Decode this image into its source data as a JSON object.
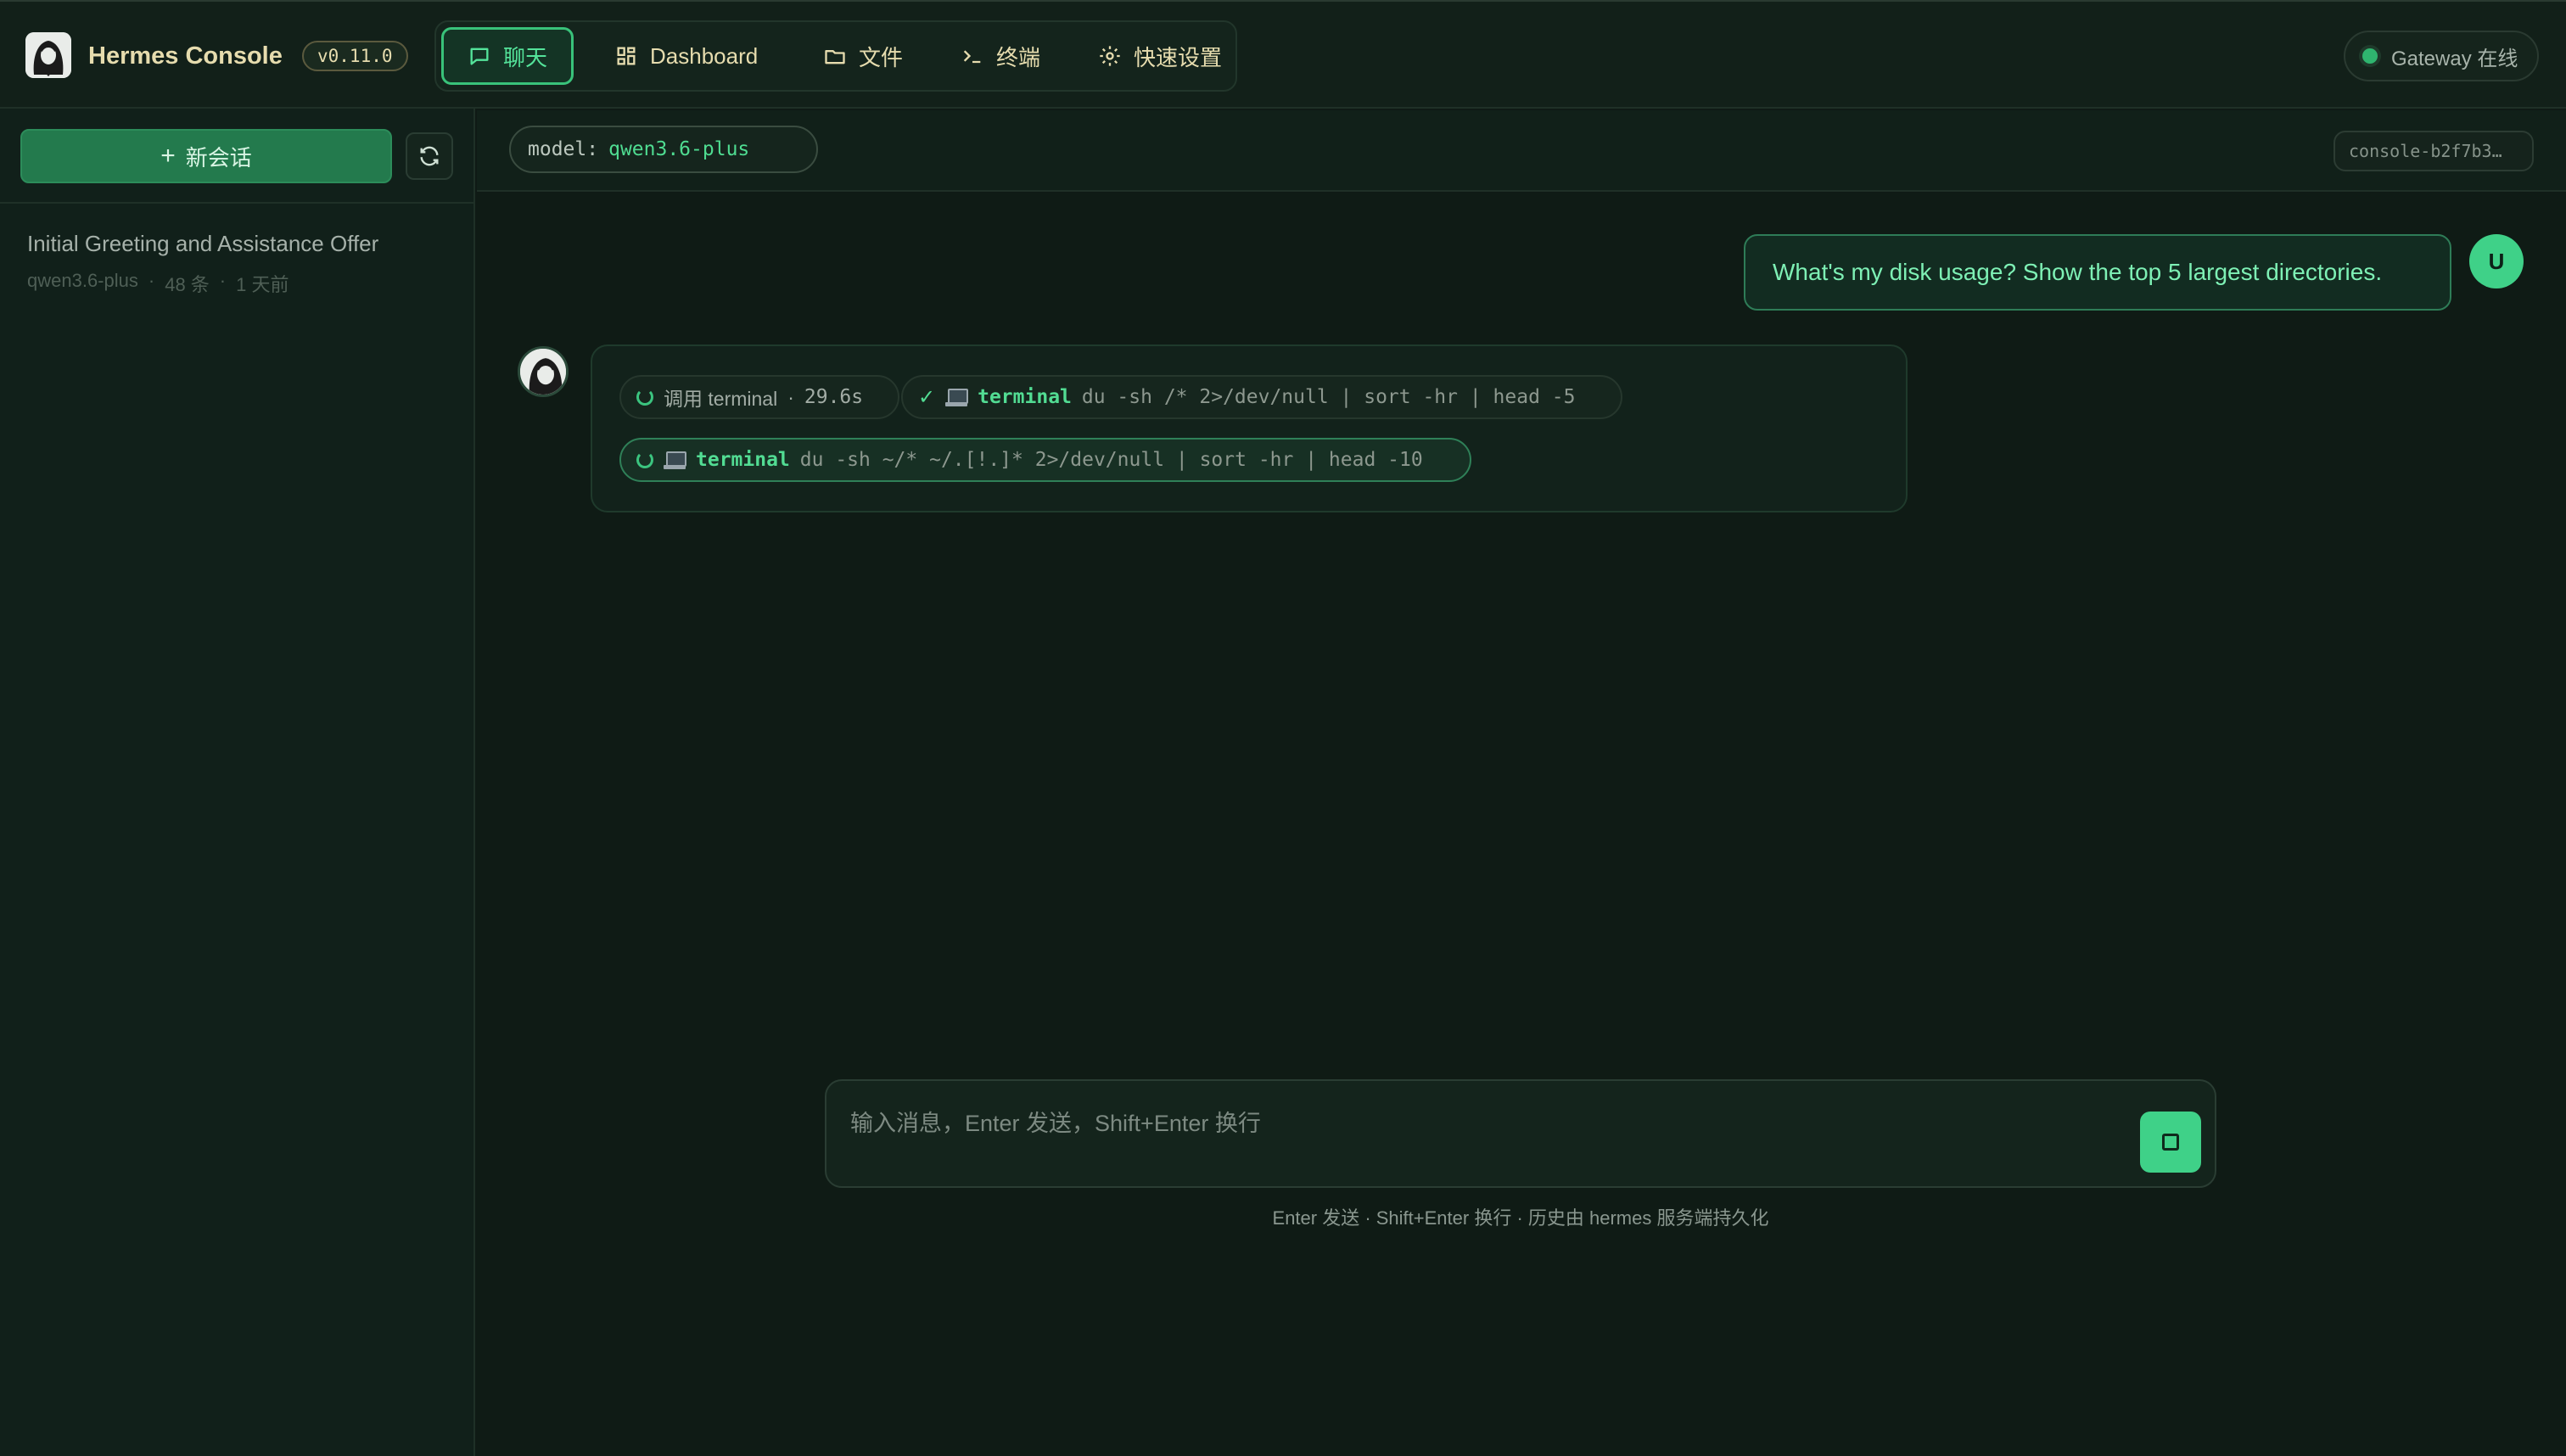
{
  "header": {
    "app_title": "Hermes Console",
    "version": "v0.11.0",
    "nav": [
      {
        "label": "聊天",
        "icon": "chat-bubble-icon",
        "active": true
      },
      {
        "label": "Dashboard",
        "icon": "grid-icon",
        "active": false
      },
      {
        "label": "文件",
        "icon": "folder-icon",
        "active": false
      },
      {
        "label": "终端",
        "icon": "terminal-prompt-icon",
        "active": false
      },
      {
        "label": "快速设置",
        "icon": "gear-icon",
        "active": false
      }
    ],
    "gateway_status": "Gateway 在线",
    "gateway_status_color": "#2fb56f"
  },
  "sidebar": {
    "new_chat_label": "新会话",
    "sessions": [
      {
        "title": "Initial Greeting and Assistance Offer",
        "model": "qwen3.6-plus",
        "count": "48 条",
        "time": "1 天前"
      }
    ]
  },
  "topbar": {
    "model_label": "model:",
    "model_value": "qwen3.6-plus",
    "session_id": "console-b2f7b3…"
  },
  "messages": {
    "user": {
      "avatar_initial": "U",
      "text": "What's my disk usage? Show the top 5 largest directories."
    },
    "assistant": {
      "call_label": "调用 terminal",
      "call_duration": "29.6s",
      "tool_calls": [
        {
          "status": "done",
          "tool": "terminal",
          "command": "du -sh /* 2>/dev/null | sort -hr | head -5"
        },
        {
          "status": "running",
          "tool": "terminal",
          "command": "du -sh ~/* ~/.[!.]* 2>/dev/null | sort -hr | head -10"
        }
      ]
    }
  },
  "composer": {
    "placeholder": "输入消息，Enter 发送，Shift+Enter 换行",
    "hint": "Enter 发送 · Shift+Enter 换行 · 历史由 hermes 服务端持久化"
  },
  "colors": {
    "accent": "#3fd188",
    "background": "#0f1b15",
    "title_gold": "#e6dcae"
  }
}
